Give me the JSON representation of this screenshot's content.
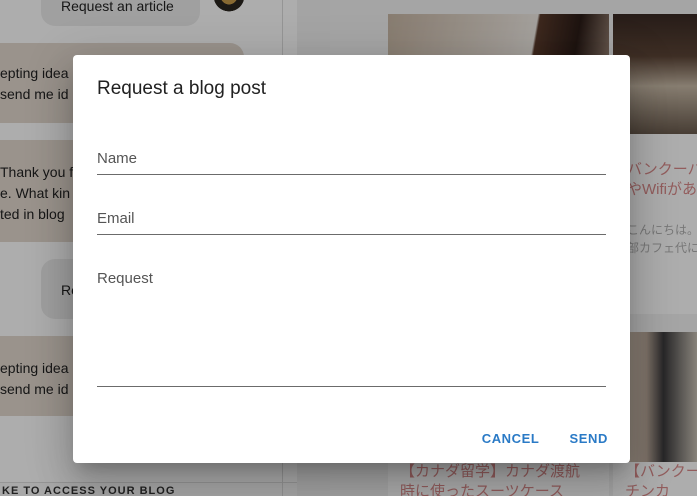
{
  "chat": {
    "messages": [
      {
        "role": "user",
        "lines": [
          "Request an article"
        ]
      },
      {
        "role": "bot",
        "lines": [
          "epting idea",
          "send me id"
        ]
      },
      {
        "role": "bot",
        "lines": [
          "Thank you f",
          "e. What kin",
          "ted in blog"
        ]
      },
      {
        "role": "user",
        "lines": [
          "Re"
        ]
      },
      {
        "role": "bot",
        "lines": [
          "epting idea",
          "send me id"
        ]
      }
    ],
    "banner": "KE TO ACCESS YOUR BLOG"
  },
  "blog": {
    "cards": [
      {
        "title": "バンクーバ",
        "title2": "やWifiがあ",
        "text": "こんにちは。",
        "text2": "部カフェ代に"
      },
      {
        "title": "【カナダ留学】カナダ渡航",
        "title2": "時に使ったスーツケース"
      },
      {
        "title": "【バンクー",
        "title2": "チンカ"
      }
    ]
  },
  "dialog": {
    "title": "Request a blog post",
    "fields": {
      "name": {
        "label": "Name",
        "value": ""
      },
      "email": {
        "label": "Email",
        "value": ""
      },
      "request": {
        "label": "Request",
        "value": ""
      }
    },
    "buttons": {
      "cancel": "CANCEL",
      "send": "SEND"
    }
  },
  "colors": {
    "accent": "#2a7ac6",
    "scrim": "rgba(0,0,0,0.32)",
    "bot_bubble": "#e3d9cf",
    "user_bubble": "#ececec"
  }
}
